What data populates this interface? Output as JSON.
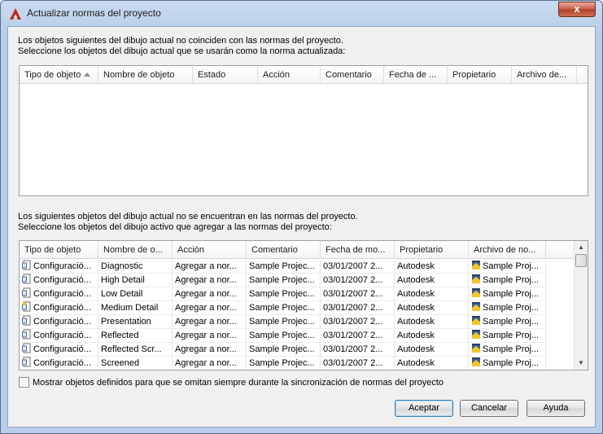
{
  "window": {
    "title": "Actualizar normas del proyecto",
    "close_label": "x",
    "icons": {
      "app": "autocad-a-icon",
      "close": "close-icon"
    },
    "colors": {
      "close": "#c75a44",
      "frame": "#b9cfe9"
    }
  },
  "top_section": {
    "message_line1": "Los objetos siguientes del dibujo actual no coinciden con las normas del proyecto.",
    "message_line2": "Seleccione los objetos del dibujo actual que se usarán como la norma actualizada:",
    "columns": [
      "Tipo de objeto",
      "Nombre de objeto",
      "Estado",
      "Acción",
      "Comentario",
      "Fecha de ...",
      "Propietario",
      "Archivo de..."
    ],
    "rows": []
  },
  "bottom_section": {
    "message_line1": "Los siguientes objetos del dibujo actual no se encuentran en las normas del proyecto.",
    "message_line2": "Seleccione los objetos del dibujo activo que agregar a las normas del proyecto:",
    "columns": [
      "Tipo de objeto",
      "Nombre de o...",
      "Acción",
      "Comentario",
      "Fecha de mo...",
      "Propietario",
      "Archivo de no..."
    ],
    "rows": [
      {
        "type": "Configuració...",
        "name": "Diagnostic",
        "action": "Agregar a nor...",
        "comment": "Sample Projec...",
        "date": "03/01/2007 2...",
        "owner": "Autodesk",
        "file": "Sample Proj...",
        "icon": "plot-config-icon"
      },
      {
        "type": "Configuració...",
        "name": "High Detail",
        "action": "Agregar a nor...",
        "comment": "Sample Projec...",
        "date": "03/01/2007 2...",
        "owner": "Autodesk",
        "file": "Sample Proj...",
        "icon": "plot-config-icon"
      },
      {
        "type": "Configuració...",
        "name": "Low Detail",
        "action": "Agregar a nor...",
        "comment": "Sample Projec...",
        "date": "03/01/2007 2...",
        "owner": "Autodesk",
        "file": "Sample Proj...",
        "icon": "plot-config-icon"
      },
      {
        "type": "Configuració...",
        "name": "Medium Detail",
        "action": "Agregar a nor...",
        "comment": "Sample Projec...",
        "date": "03/01/2007 2...",
        "owner": "Autodesk",
        "file": "Sample Proj...",
        "icon": "plot-config-star-icon"
      },
      {
        "type": "Configuració...",
        "name": "Presentation",
        "action": "Agregar a nor...",
        "comment": "Sample Projec...",
        "date": "03/01/2007 2...",
        "owner": "Autodesk",
        "file": "Sample Proj...",
        "icon": "plot-config-icon"
      },
      {
        "type": "Configuració...",
        "name": "Reflected",
        "action": "Agregar a nor...",
        "comment": "Sample Projec...",
        "date": "03/01/2007 2...",
        "owner": "Autodesk",
        "file": "Sample Proj...",
        "icon": "plot-config-icon"
      },
      {
        "type": "Configuració...",
        "name": "Reflected Scr...",
        "action": "Agregar a nor...",
        "comment": "Sample Projec...",
        "date": "03/01/2007 2...",
        "owner": "Autodesk",
        "file": "Sample Proj...",
        "icon": "plot-config-icon"
      },
      {
        "type": "Configuració...",
        "name": "Screened",
        "action": "Agregar a nor...",
        "comment": "Sample Projec...",
        "date": "03/01/2007 2...",
        "owner": "Autodesk",
        "file": "Sample Proj...",
        "icon": "plot-config-icon"
      }
    ]
  },
  "checkbox": {
    "label": "Mostrar objetos definidos para que se omitan siempre durante la sincronización de normas del proyecto",
    "checked": false
  },
  "buttons": {
    "accept": "Aceptar",
    "cancel": "Cancelar",
    "help": "Ayuda"
  }
}
